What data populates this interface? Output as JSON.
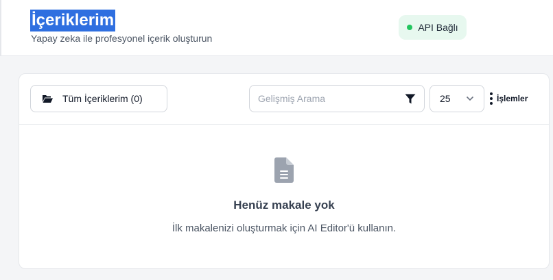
{
  "header": {
    "title": "İçeriklerim",
    "subtitle": "Yapay zeka ile profesyonel içerik oluşturun",
    "api_status": "API Bağlı",
    "status_color": "#22c55e"
  },
  "toolbar": {
    "all_contents_label": "Tüm İçeriklerim (0)",
    "search_placeholder": "Gelişmiş Arama",
    "per_page_value": "25",
    "actions_label": "İşlemler"
  },
  "empty_state": {
    "title": "Henüz makale yok",
    "message": "İlk makalenizi oluşturmak için AI Editor'ü kullanın.",
    "icon": "document-icon"
  },
  "colors": {
    "title_highlight": "#2f6fe0",
    "badge_bg": "#e7f8ef",
    "icon_gray": "#9ca3af"
  }
}
